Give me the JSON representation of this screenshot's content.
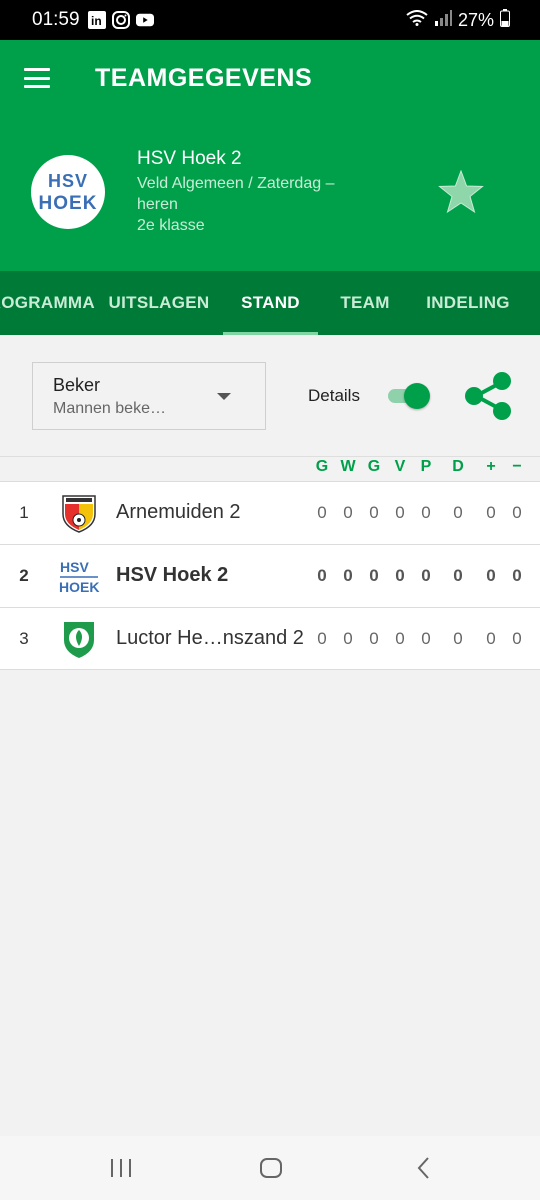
{
  "status": {
    "time": "01:59",
    "battery": "27%"
  },
  "header": {
    "title": "TEAMGEGEVENS",
    "team_name": "HSV Hoek 2",
    "team_info_line1": "Veld Algemeen / Zaterdag –",
    "team_info_line2": "heren",
    "team_info_line3": "2e klasse",
    "logo_text_top": "HSV",
    "logo_text_bottom": "HOEK"
  },
  "tabs": [
    {
      "label": "PROGRAMMA"
    },
    {
      "label": "UITSLAGEN"
    },
    {
      "label": "STAND",
      "active": true
    },
    {
      "label": "TEAM"
    },
    {
      "label": "INDELING"
    }
  ],
  "filter": {
    "label": "Beker",
    "value": "Mannen beke…"
  },
  "details": {
    "label": "Details",
    "enabled": true
  },
  "table": {
    "columns": [
      "G",
      "W",
      "G",
      "V",
      "P",
      "D",
      "+",
      "−"
    ],
    "rows": [
      {
        "pos": "1",
        "name": "Arnemuiden 2",
        "stats": [
          "0",
          "0",
          "0",
          "0",
          "0",
          "0",
          "0",
          "0"
        ],
        "highlight": false
      },
      {
        "pos": "2",
        "name": "HSV Hoek 2",
        "stats": [
          "0",
          "0",
          "0",
          "0",
          "0",
          "0",
          "0",
          "0"
        ],
        "highlight": true
      },
      {
        "pos": "3",
        "name": "Luctor He…nszand 2",
        "stats": [
          "0",
          "0",
          "0",
          "0",
          "0",
          "0",
          "0",
          "0"
        ],
        "highlight": false
      }
    ]
  },
  "colors": {
    "primary": "#00a04b",
    "primary_dark": "#007a37",
    "accent_light": "#7fd6a3"
  }
}
